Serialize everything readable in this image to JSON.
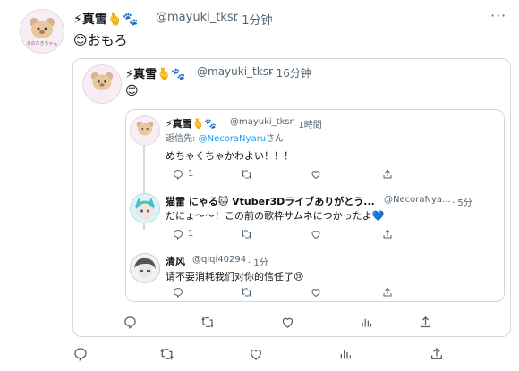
{
  "outer_tweet": {
    "name": "⚡真雪🫰🐾",
    "handle": "@mayuki_tksr",
    "time": "· 1分钟",
    "text": "😊おもろ"
  },
  "quoted_tweet": {
    "name": "⚡真雪🫰🐾",
    "handle": "@mayuki_tksr",
    "time": "· 16分钟",
    "text": "😊"
  },
  "inner_card": {
    "tweet1": {
      "name": "⚡真雪🫰🐾",
      "handle": "@mayuki_tksr",
      "time": "· 1時間",
      "reply_prefix": "返信先: ",
      "reply_to": "@NecoraNyaru",
      "reply_suffix": "さん",
      "text": "めちゃくちゃかわよい！！！",
      "reply_count": "1"
    },
    "tweet2": {
      "name": "猫雷 にゃる🐱 Vtuber3Dライブありがとう...",
      "handle": "@NecoraNya...",
      "time": "· 5分",
      "text": "だにょ～～！この前の歌枠サムネにつかったよ💙",
      "reply_count": "1"
    },
    "tweet3": {
      "name": "清风",
      "handle": "@qiqi40294",
      "time": "· 1分",
      "text": "请不要消耗我们对你的信任了😢"
    }
  },
  "avatar_text": "まのたきちゃん"
}
